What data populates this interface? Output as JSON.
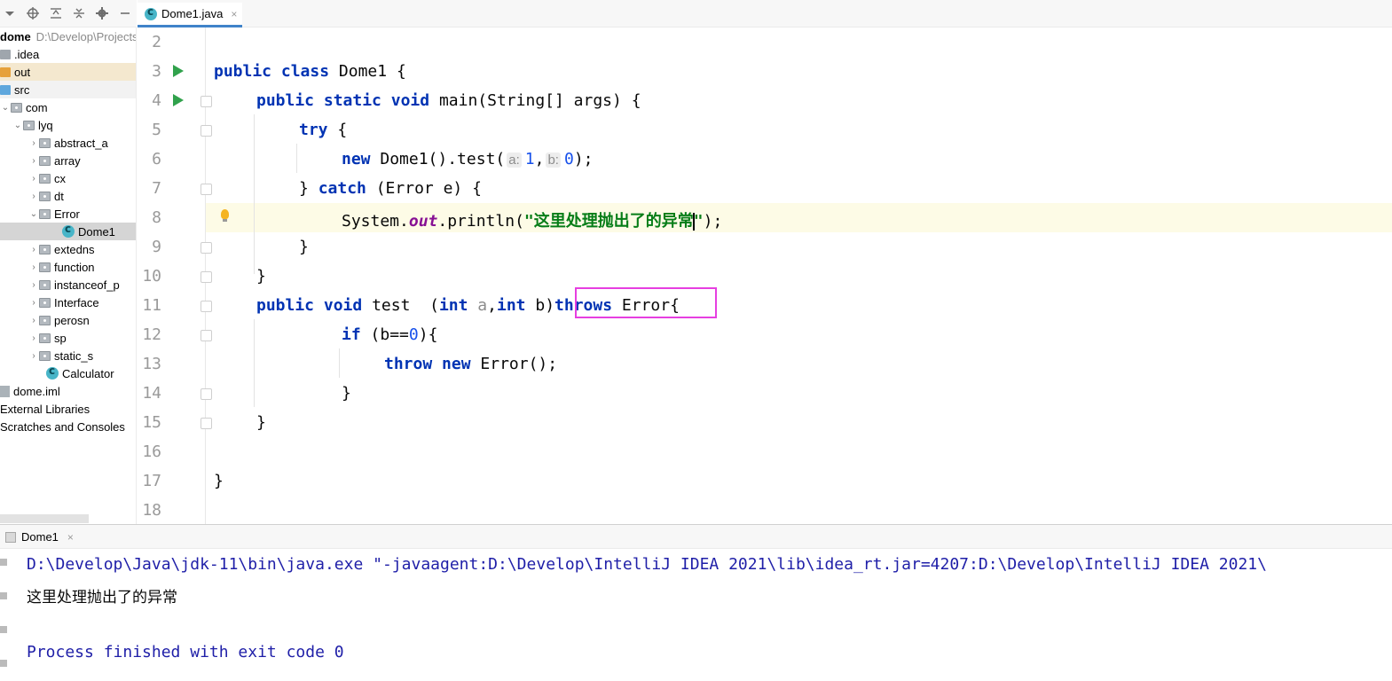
{
  "tab": {
    "label": "Dome1.java",
    "close": "×"
  },
  "tree": {
    "root_name": "dome",
    "root_path": "D:\\Develop\\Projects",
    "items": {
      "idea": ".idea",
      "out": "out",
      "src": "src",
      "com": "com",
      "lyq": "lyq",
      "abstract_a": "abstract_a",
      "array": "array",
      "cx": "cx",
      "dt": "dt",
      "error": "Error",
      "dome1": "Dome1",
      "extedns": "extedns",
      "function": "function",
      "instanceof_p": "instanceof_p",
      "interface": "Interface",
      "perosn": "perosn",
      "sp": "sp",
      "static_s": "static_s",
      "calculator": "Calculator",
      "dome_iml": "dome.iml",
      "external_libraries": "External Libraries",
      "scratches": "Scratches and Consoles"
    }
  },
  "editor": {
    "line_numbers": [
      "2",
      "3",
      "4",
      "5",
      "6",
      "7",
      "8",
      "9",
      "10",
      "11",
      "12",
      "13",
      "14",
      "15",
      "16",
      "17",
      "18"
    ],
    "tokens": {
      "public": "public",
      "class": "class",
      "static": "static",
      "void": "void",
      "try": "try",
      "new": "new",
      "catch": "catch",
      "int": "int",
      "throws": "throws",
      "if": "if",
      "throw": "throw",
      "class_name": "Dome1",
      "main_sig": "main(String[] args) {",
      "dome1_call": "Dome1().test(",
      "hint_a": "a:",
      "hint_b": "b:",
      "arg1": "1",
      "arg2": "0",
      "call_end": ");",
      "catch_open": "} ",
      "catch_sig": "(Error e) {",
      "system": "System.",
      "out_field": "out",
      "println": ".println(",
      "string_value": "\"这里处理抛出了的异常",
      "string_close": "\"",
      "println_end": ");",
      "test_name": "test  (",
      "param_a": "a",
      "param_b": "b",
      "error_brace": "Error{",
      "if_open": "(b==",
      "if_zero": "0",
      "if_close": "){",
      "error_new": "Error();",
      "open_brace": "{",
      "close_brace": "}",
      "comma": ",",
      "space": " "
    }
  },
  "run_panel": {
    "tab_label": "Dome1",
    "tab_close": "×",
    "console": {
      "command": "D:\\Develop\\Java\\jdk-11\\bin\\java.exe \"-javaagent:D:\\Develop\\IntelliJ IDEA 2021\\lib\\idea_rt.jar=4207:D:\\Develop\\IntelliJ IDEA 2021\\",
      "output": "这里处理抛出了的异常",
      "exit_message": "Process finished with exit code 0"
    }
  },
  "colors": {
    "keyword": "#0033b3",
    "string": "#067d17",
    "number": "#1750eb",
    "field": "#871094",
    "annotation_box": "#e63fe0",
    "run_icon": "#31a24c"
  }
}
